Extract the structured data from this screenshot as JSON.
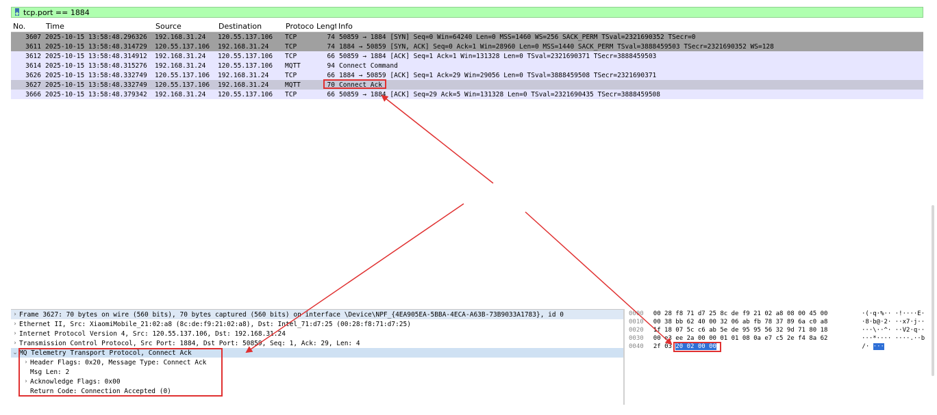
{
  "filter": {
    "value": "tcp.port == 1884"
  },
  "columns": [
    "No.",
    "Time",
    "Source",
    "Destination",
    "Protoco",
    "Lengt",
    "Info"
  ],
  "packets": [
    {
      "no": "3607",
      "time": "2025-10-15 13:58:48.296326",
      "src": "192.168.31.24",
      "dst": "120.55.137.106",
      "proto": "TCP",
      "len": "74",
      "info": "50859 → 1884 [SYN] Seq=0 Win=64240 Len=0 MSS=1460 WS=256 SACK_PERM TSval=2321690352 TSecr=0"
    },
    {
      "no": "3611",
      "time": "2025-10-15 13:58:48.314729",
      "src": "120.55.137.106",
      "dst": "192.168.31.24",
      "proto": "TCP",
      "len": "74",
      "info": "1884 → 50859 [SYN, ACK] Seq=0 Ack=1 Win=28960 Len=0 MSS=1440 SACK_PERM TSval=3888459503 TSecr=2321690352 WS=128"
    },
    {
      "no": "3612",
      "time": "2025-10-15 13:58:48.314912",
      "src": "192.168.31.24",
      "dst": "120.55.137.106",
      "proto": "TCP",
      "len": "66",
      "info": "50859 → 1884 [ACK] Seq=1 Ack=1 Win=131328 Len=0 TSval=2321690371 TSecr=3888459503"
    },
    {
      "no": "3614",
      "time": "2025-10-15 13:58:48.315276",
      "src": "192.168.31.24",
      "dst": "120.55.137.106",
      "proto": "MQTT",
      "len": "94",
      "info": "Connect Command"
    },
    {
      "no": "3626",
      "time": "2025-10-15 13:58:48.332749",
      "src": "120.55.137.106",
      "dst": "192.168.31.24",
      "proto": "TCP",
      "len": "66",
      "info": "1884 → 50859 [ACK] Seq=1 Ack=29 Win=29056 Len=0 TSval=3888459508 TSecr=2321690371"
    },
    {
      "no": "3627",
      "time": "2025-10-15 13:58:48.332749",
      "src": "120.55.137.106",
      "dst": "192.168.31.24",
      "proto": "MQTT",
      "len": "70",
      "info": "Connect Ack"
    },
    {
      "no": "3666",
      "time": "2025-10-15 13:58:48.379342",
      "src": "192.168.31.24",
      "dst": "120.55.137.106",
      "proto": "TCP",
      "len": "66",
      "info": "50859 → 1884 [ACK] Seq=29 Ack=5 Win=131328 Len=0 TSval=2321690435 TSecr=3888459508"
    }
  ],
  "details": {
    "frame": "Frame 3627: 70 bytes on wire (560 bits), 70 bytes captured (560 bits) on interface \\Device\\NPF_{4EA905EA-5BBA-4ECA-A63B-73B9033A1783}, id 0",
    "ethernet": "Ethernet II, Src: XiaomiMobile_21:02:a8 (8c:de:f9:21:02:a8), Dst: Intel_71:d7:25 (00:28:f8:71:d7:25)",
    "ip": "Internet Protocol Version 4, Src: 120.55.137.106, Dst: 192.168.31.24",
    "tcp": "Transmission Control Protocol, Src Port: 1884, Dst Port: 50859, Seq: 1, Ack: 29, Len: 4",
    "mqtt": "MQ Telemetry Transport Protocol, Connect Ack",
    "header_flags": "Header Flags: 0x20, Message Type: Connect Ack",
    "msg_len": "Msg Len: 2",
    "ack_flags": "Acknowledge Flags: 0x00",
    "return_code": "Return Code: Connection Accepted (0)"
  },
  "hex": [
    {
      "off": "0000",
      "bytes": "00 28 f8 71 d7 25 8c de  f9 21 02 a8 08 00 45 00",
      "ascii": "·(·q·%··  ·!····E·"
    },
    {
      "off": "0010",
      "bytes": "00 38 bb 62 40 00 32 06  ab fb 78 37 89 6a c0 a8",
      "ascii": "·8·b@·2·  ··x7·j··"
    },
    {
      "off": "0020",
      "bytes": "1f 18 07 5c c6 ab 5e de  95 95 56 32 9d 71 80 18",
      "ascii": "···\\··^·  ··V2·q··"
    },
    {
      "off": "0030",
      "bytes": "00 e3 ee 2a 00 00 01 01  08 0a e7 c5 2e f4 8a 62",
      "ascii": "···*····  ····.··b"
    },
    {
      "off": "0040",
      "bytes_plain": "2f 03 ",
      "bytes_hl": "20 02 00 00",
      "ascii_plain": "/·",
      "ascii_hl": "···"
    }
  ]
}
